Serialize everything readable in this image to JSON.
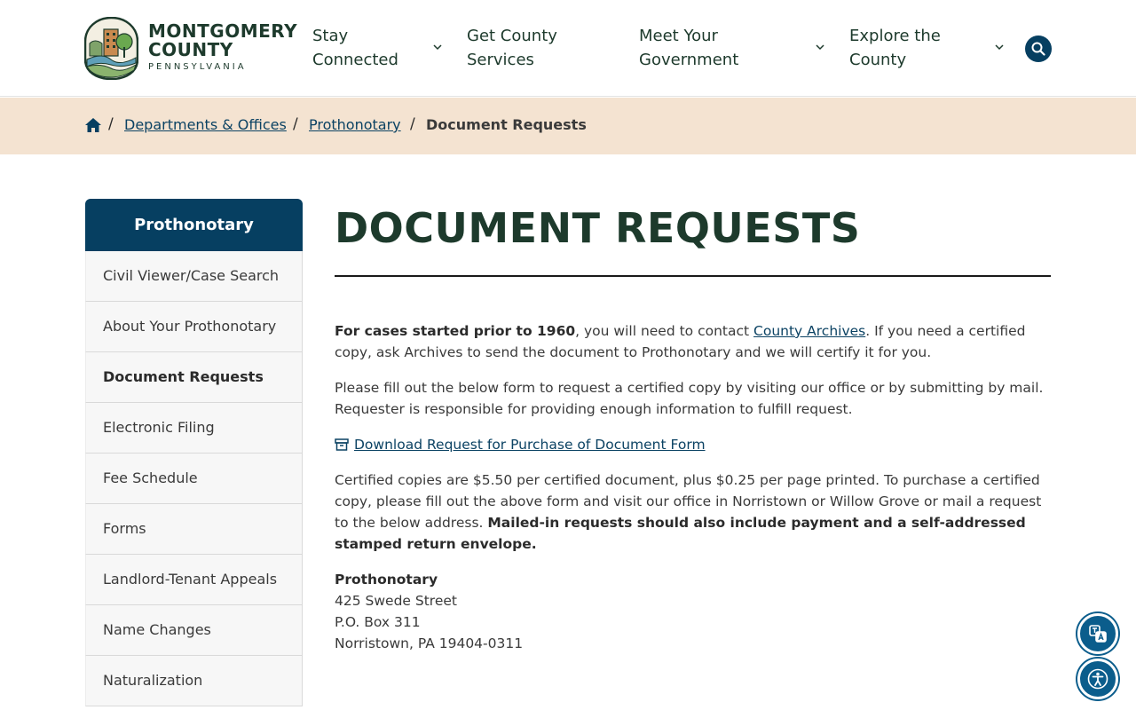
{
  "header": {
    "logo": {
      "line1": "MONTGOMERY",
      "line2": "COUNTY",
      "line3": "PENNSYLVANIA"
    },
    "nav": [
      {
        "label": "Stay\nConnected"
      },
      {
        "label": "Get County\nServices"
      },
      {
        "label": "Meet Your\nGovernment"
      },
      {
        "label": "Explore the\nCounty"
      }
    ],
    "search_icon": "search-icon"
  },
  "breadcrumb": {
    "home_icon": "home-icon",
    "separator": "/",
    "links": [
      {
        "label": "Departments & Offices"
      },
      {
        "label": "Prothonotary"
      }
    ],
    "current": "Document Requests"
  },
  "sidebar": {
    "title": "Prothonotary",
    "items": [
      {
        "label": "Civil Viewer/Case Search"
      },
      {
        "label": "About Your Prothonotary"
      },
      {
        "label": "Document Requests",
        "active": true
      },
      {
        "label": "Electronic Filing"
      },
      {
        "label": "Fee Schedule"
      },
      {
        "label": "Forms"
      },
      {
        "label": "Landlord-Tenant Appeals"
      },
      {
        "label": "Name Changes"
      },
      {
        "label": "Naturalization"
      }
    ]
  },
  "main": {
    "title": "DOCUMENT REQUESTS",
    "p1": {
      "bold": "For cases started prior to 1960",
      "text_before_link": ", you will need to contact ",
      "link": "County Archives",
      "text_after_link": ". If you need a certified copy, ask Archives to send the document to Prothonotary and we will certify it for you."
    },
    "p2": "Please fill out the below form to request a certified copy by visiting our office or by submitting by mail. Requester is responsible for providing enough information to fulfill request.",
    "download": {
      "icon": "archive-box-icon",
      "label": "Download Request for Purchase of Document Form"
    },
    "p3": {
      "text": "Certified copies are $5.50 per certified document, plus $0.25 per page printed. To purchase a certified copy, please fill out the above form and visit our office in Norristown or Willow Grove or mail a request to the below address. ",
      "bold": "Mailed-in requests should also include payment and a self-addressed stamped return envelope."
    },
    "address": {
      "name": "Prothonotary",
      "street": "425 Swede Street",
      "po": "P.O. Box 311",
      "city": "Norristown, PA 19404-0311"
    }
  },
  "floating": {
    "translate_icon": "translate-icon",
    "accessibility_icon": "accessibility-icon"
  },
  "colors": {
    "navy": "#063f61",
    "forest": "#1d3a2c",
    "breadcrumb_bg": "#f4e3d1",
    "link": "#0b4263",
    "float_blue": "#0b5d8c"
  }
}
